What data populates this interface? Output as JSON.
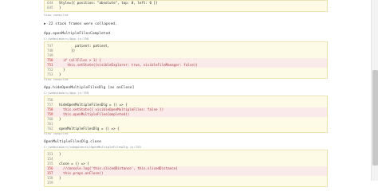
{
  "top_block": {
    "lines": [
      {
        "num": "644",
        "text": "Style={{ position: \"absolute\", top: 0, left: 0 }}",
        "hl": false
      },
      {
        "num": "645",
        "text": "}",
        "hl": false
      }
    ]
  },
  "view_compiled_label": "View compiled",
  "collapsed_notice": {
    "arrow": "▶",
    "text": "22 stack frames were collapsed."
  },
  "frames": [
    {
      "title": "App.openMultipleFilesCompleted",
      "path": "C:/webviewsrc/App.js:750",
      "lines": [
        {
          "num": "747",
          "text": "        patient: patient,",
          "hl": false
        },
        {
          "num": "748",
          "text": "      })",
          "hl": false
        },
        {
          "num": "749",
          "text": "",
          "hl": false
        },
        {
          "num": "750",
          "text": "  if (allFiles > 1) {",
          "hl": true
        },
        {
          "num": "751",
          "text": "    this.setState({visibleExplorer: true, visibleFileManager: false})",
          "hl": true
        },
        {
          "num": "752",
          "text": "  }",
          "hl": false
        },
        {
          "num": "753",
          "text": "}",
          "hl": false
        }
      ]
    },
    {
      "title": "App.hideOpenMultipleFilesDlg [as onClose]",
      "path": "C:/webviewsrc/App.js:759",
      "lines": [
        {
          "num": "756",
          "text": "",
          "hl": false
        },
        {
          "num": "757",
          "text": "hideOpenMultipleFilesDlg = () => {",
          "hl": false
        },
        {
          "num": "758",
          "text": "  this.setState({ visibleOpenMultipleFiles: false })",
          "hl": true
        },
        {
          "num": "759",
          "text": "  this.openMultipleFilesCompleted()",
          "hl": true
        },
        {
          "num": "760",
          "text": "}",
          "hl": false
        },
        {
          "num": "761",
          "text": "",
          "hl": false
        },
        {
          "num": "762",
          "text": "openMultipleFilesDlg = () => {",
          "hl": false
        }
      ]
    },
    {
      "title": "OpenMultipleFilesDlg.close",
      "path": "C:/webviewsrc/components/OpenMultipleFilesDlg.js:155",
      "lines": [
        {
          "num": "153",
          "text": "}",
          "hl": false
        },
        {
          "num": "154",
          "text": "",
          "hl": false
        },
        {
          "num": "155",
          "text": "close = () => {",
          "hl": false
        },
        {
          "num": "156",
          "text": "  //console.log('this.slicedDistance', this.slicedDistance)",
          "hl": true
        },
        {
          "num": "157",
          "text": "  this.props.onClose()",
          "hl": true
        },
        {
          "num": "158",
          "text": "}",
          "hl": false
        },
        {
          "num": "159",
          "text": "",
          "hl": false
        }
      ]
    }
  ]
}
